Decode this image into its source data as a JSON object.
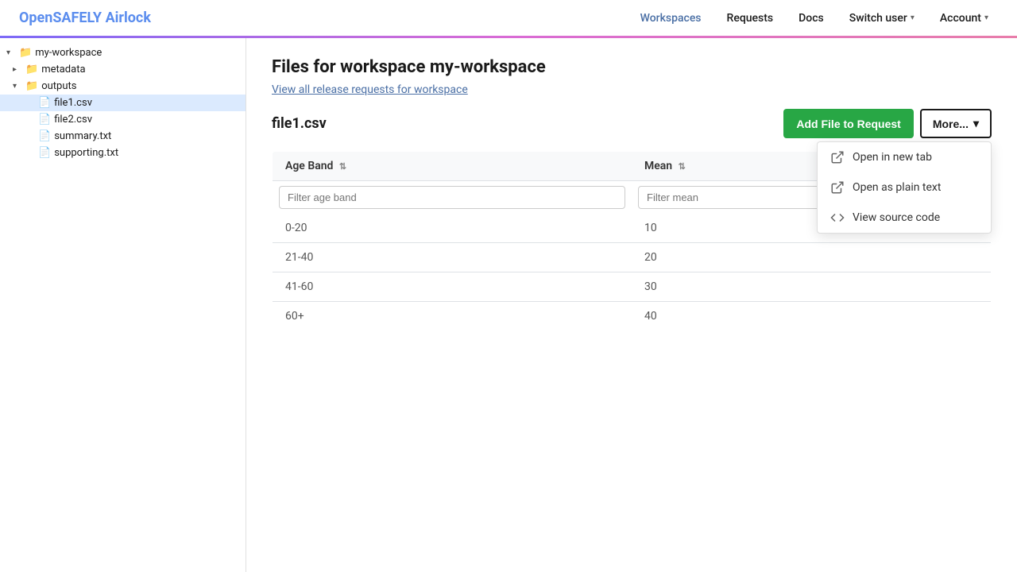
{
  "brand": {
    "part1": "OpenSAFELY",
    "part2": "Airlock"
  },
  "nav": {
    "workspaces": "Workspaces",
    "requests": "Requests",
    "docs": "Docs",
    "switch_user": "Switch user",
    "account": "Account"
  },
  "page": {
    "title": "Files for workspace my-workspace",
    "subtitle_link": "View all release requests for workspace"
  },
  "sidebar": {
    "items": [
      {
        "id": "my-workspace",
        "label": "my-workspace",
        "type": "folder",
        "indent": 0,
        "expanded": true,
        "toggle": "▾"
      },
      {
        "id": "metadata",
        "label": "metadata",
        "type": "folder",
        "indent": 1,
        "expanded": false,
        "toggle": "▸"
      },
      {
        "id": "outputs",
        "label": "outputs",
        "type": "folder",
        "indent": 1,
        "expanded": true,
        "toggle": "▾"
      },
      {
        "id": "file1.csv",
        "label": "file1.csv",
        "type": "file",
        "indent": 2,
        "selected": true
      },
      {
        "id": "file2.csv",
        "label": "file2.csv",
        "type": "file",
        "indent": 2,
        "selected": false
      },
      {
        "id": "summary.txt",
        "label": "summary.txt",
        "type": "file",
        "indent": 2,
        "selected": false
      },
      {
        "id": "supporting.txt",
        "label": "supporting.txt",
        "type": "file",
        "indent": 2,
        "selected": false
      }
    ]
  },
  "file": {
    "name": "file1.csv",
    "add_button": "Add File to Request",
    "more_button": "More...",
    "columns": [
      {
        "id": "age_band",
        "label": "Age Band"
      },
      {
        "id": "mean",
        "label": "Mean"
      }
    ],
    "filters": {
      "age_band_placeholder": "Filter age band",
      "mean_placeholder": "Filter mean"
    },
    "rows": [
      {
        "age_band": "0-20",
        "mean": "10"
      },
      {
        "age_band": "21-40",
        "mean": "20"
      },
      {
        "age_band": "41-60",
        "mean": "30"
      },
      {
        "age_band": "60+",
        "mean": "40"
      }
    ]
  },
  "dropdown": {
    "items": [
      {
        "id": "open-new-tab",
        "label": "Open in new tab",
        "icon": "external-link-icon"
      },
      {
        "id": "open-plain-text",
        "label": "Open as plain text",
        "icon": "external-link-icon"
      },
      {
        "id": "view-source",
        "label": "View source code",
        "icon": "code-icon"
      }
    ]
  }
}
